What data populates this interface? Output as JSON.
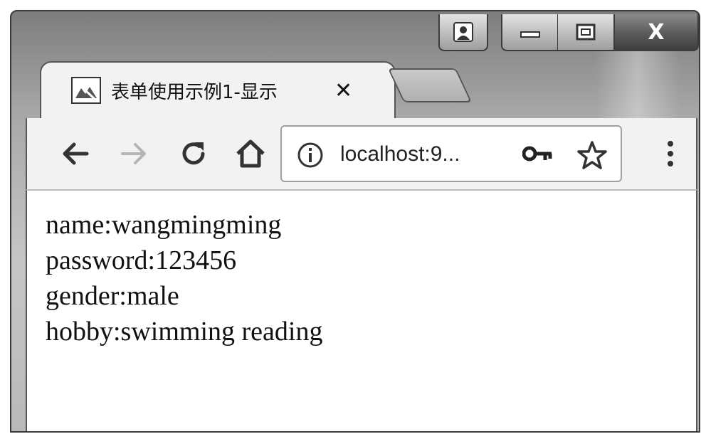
{
  "window": {
    "caption_buttons": [
      {
        "name": "user-icon"
      },
      {
        "name": "minimize-icon"
      },
      {
        "name": "maximize-icon"
      },
      {
        "name": "close-window-icon",
        "glyph": "X"
      }
    ]
  },
  "tab": {
    "title": "表单使用示例1-显示",
    "close_glyph": "✕",
    "favicon": "broken-image-icon"
  },
  "toolbar": {
    "back_icon": "back-arrow-icon",
    "forward_icon": "forward-arrow-icon",
    "reload_icon": "reload-icon",
    "home_icon": "home-icon",
    "address": "localhost:9...",
    "info_icon": "info-icon",
    "key_icon": "key-icon",
    "star_icon": "star-icon",
    "menu_icon": "more-vert-icon"
  },
  "content": {
    "lines": [
      "name:wangmingming",
      "password:123456",
      "gender:male",
      "hobby:swimming reading"
    ]
  }
}
